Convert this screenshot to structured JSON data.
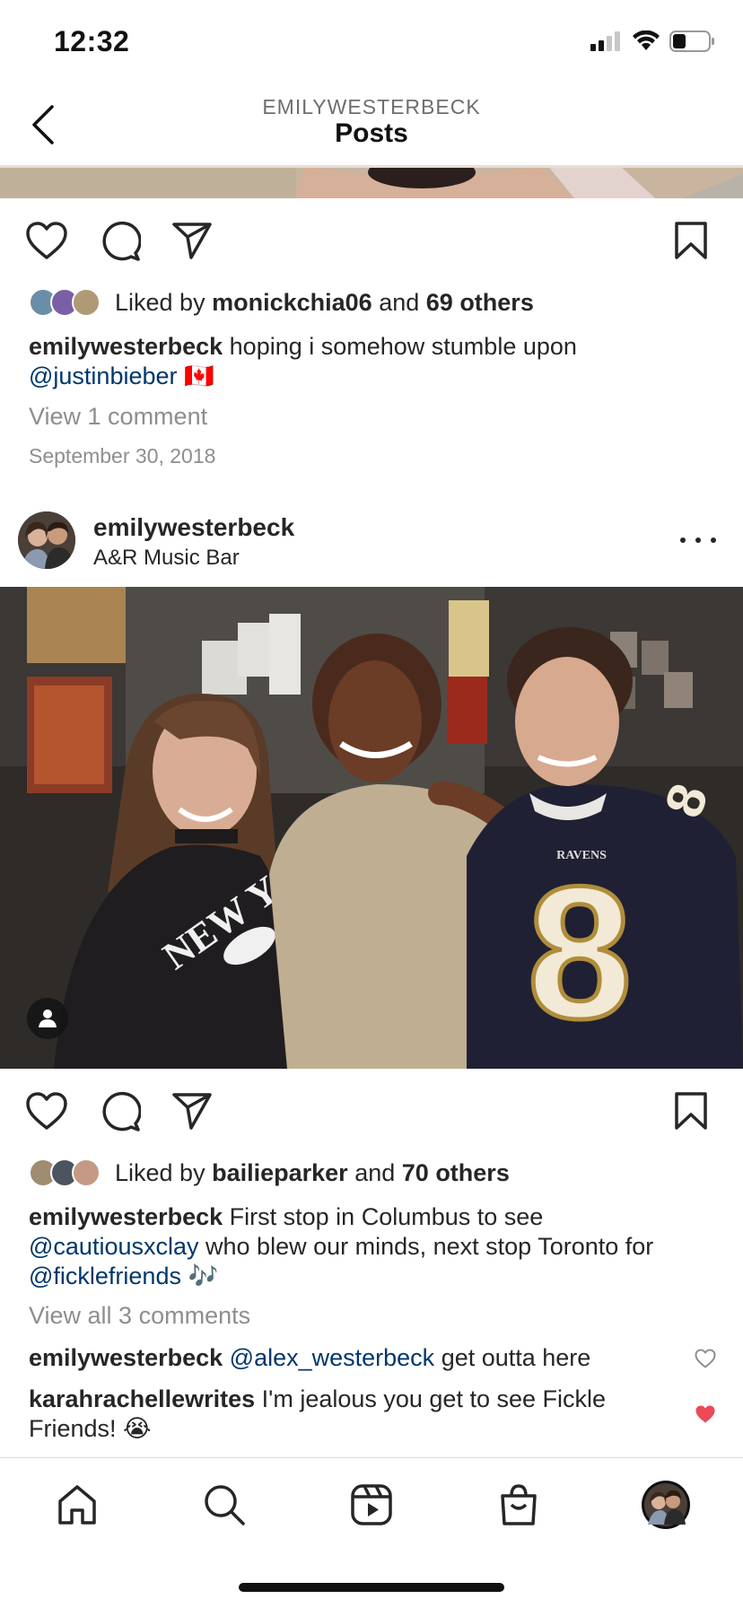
{
  "status": {
    "time": "12:32"
  },
  "nav": {
    "username": "EMILYWESTERBECK",
    "title": "Posts"
  },
  "icons": {
    "back": "chevron-left-icon",
    "like": "heart-icon",
    "comment": "comment-icon",
    "share": "send-icon",
    "save": "bookmark-icon",
    "more": "more-horizontal-icon",
    "tag": "user-tag-icon",
    "home": "home-icon",
    "search": "search-icon",
    "reels": "reels-icon",
    "shop": "shopping-bag-icon",
    "profile": "profile-avatar"
  },
  "colors": {
    "mention": "#00376b",
    "muted": "#8e8e8e",
    "liked_heart": "#ed4956",
    "text": "#262626"
  },
  "prev_post": {
    "likes": {
      "prefix": "Liked by",
      "user": "monickchia06",
      "middle": "and",
      "count": "69 others"
    },
    "caption": {
      "user": "emilywesterbeck",
      "text": "hoping i somehow stumble upon",
      "mention": "@justinbieber",
      "emoji": "🇨🇦"
    },
    "view_comments": "View 1 comment",
    "date": "September 30, 2018"
  },
  "post": {
    "username": "emilywesterbeck",
    "location": "A&R Music Bar",
    "likes": {
      "prefix": "Liked by",
      "user": "bailieparker",
      "middle": "and",
      "count": "70 others"
    },
    "caption": {
      "user": "emilywesterbeck",
      "text1": "First stop in Columbus to see",
      "mention1": "@cautiousxclay",
      "text2": "who blew our minds, next stop Toronto for",
      "mention2": "@ficklefriends",
      "emoji": "🎶"
    },
    "view_comments": "View all 3 comments",
    "comments": [
      {
        "user": "emilywesterbeck",
        "mention": "@alex_westerbeck",
        "text": "get outta here",
        "liked": false
      },
      {
        "user": "karahrachellewrites",
        "text": "I'm jealous you get to see Fickle Friends! 😭",
        "liked": true
      }
    ]
  }
}
